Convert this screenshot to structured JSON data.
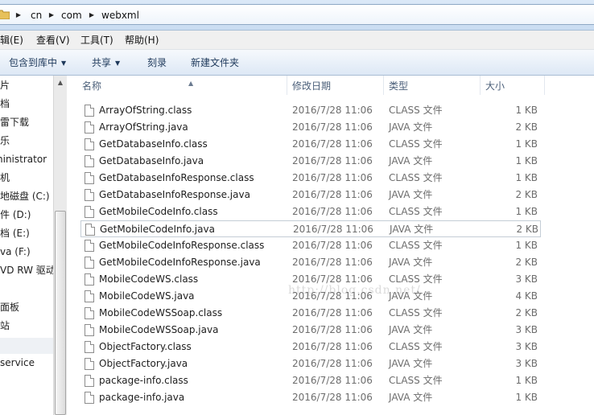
{
  "address": {
    "crumbs": [
      "cn",
      "com",
      "webxml"
    ]
  },
  "menu": [
    "编辑(E)",
    "查看(V)",
    "工具(T)",
    "帮助(H)"
  ],
  "commands": {
    "include_library": "包含到库中",
    "share": "共享",
    "burn": "刻录",
    "new_folder": "新建文件夹"
  },
  "nav": {
    "items": [
      "片",
      "档",
      "雷下载",
      "乐",
      "ninistrator",
      "机",
      "地磁盘 (C:)",
      "件 (D:)",
      "档 (E:)",
      "va (F:)",
      "VD RW 驱动",
      "面板",
      "站",
      "service"
    ]
  },
  "columns": {
    "name": "名称",
    "date": "修改日期",
    "type": "类型",
    "size": "大小"
  },
  "files": [
    {
      "name": "ArrayOfString.class",
      "date": "2016/7/28 11:06",
      "type": "CLASS 文件",
      "size": "1 KB"
    },
    {
      "name": "ArrayOfString.java",
      "date": "2016/7/28 11:06",
      "type": "JAVA 文件",
      "size": "2 KB"
    },
    {
      "name": "GetDatabaseInfo.class",
      "date": "2016/7/28 11:06",
      "type": "CLASS 文件",
      "size": "1 KB"
    },
    {
      "name": "GetDatabaseInfo.java",
      "date": "2016/7/28 11:06",
      "type": "JAVA 文件",
      "size": "1 KB"
    },
    {
      "name": "GetDatabaseInfoResponse.class",
      "date": "2016/7/28 11:06",
      "type": "CLASS 文件",
      "size": "1 KB"
    },
    {
      "name": "GetDatabaseInfoResponse.java",
      "date": "2016/7/28 11:06",
      "type": "JAVA 文件",
      "size": "2 KB"
    },
    {
      "name": "GetMobileCodeInfo.class",
      "date": "2016/7/28 11:06",
      "type": "CLASS 文件",
      "size": "1 KB"
    },
    {
      "name": "GetMobileCodeInfo.java",
      "date": "2016/7/28 11:06",
      "type": "JAVA 文件",
      "size": "2 KB"
    },
    {
      "name": "GetMobileCodeInfoResponse.class",
      "date": "2016/7/28 11:06",
      "type": "CLASS 文件",
      "size": "1 KB"
    },
    {
      "name": "GetMobileCodeInfoResponse.java",
      "date": "2016/7/28 11:06",
      "type": "JAVA 文件",
      "size": "2 KB"
    },
    {
      "name": "MobileCodeWS.class",
      "date": "2016/7/28 11:06",
      "type": "CLASS 文件",
      "size": "3 KB"
    },
    {
      "name": "MobileCodeWS.java",
      "date": "2016/7/28 11:06",
      "type": "JAVA 文件",
      "size": "4 KB"
    },
    {
      "name": "MobileCodeWSSoap.class",
      "date": "2016/7/28 11:06",
      "type": "CLASS 文件",
      "size": "2 KB"
    },
    {
      "name": "MobileCodeWSSoap.java",
      "date": "2016/7/28 11:06",
      "type": "JAVA 文件",
      "size": "3 KB"
    },
    {
      "name": "ObjectFactory.class",
      "date": "2016/7/28 11:06",
      "type": "CLASS 文件",
      "size": "3 KB"
    },
    {
      "name": "ObjectFactory.java",
      "date": "2016/7/28 11:06",
      "type": "JAVA 文件",
      "size": "3 KB"
    },
    {
      "name": "package-info.class",
      "date": "2016/7/28 11:06",
      "type": "CLASS 文件",
      "size": "1 KB"
    },
    {
      "name": "package-info.java",
      "date": "2016/7/28 11:06",
      "type": "JAVA 文件",
      "size": "1 KB"
    }
  ],
  "selected_file": "GetMobileCodeInfo.java",
  "watermark": "http://blog.csdn.net/",
  "icons": {
    "folder": "folder-icon",
    "file": "file-icon",
    "dropdown": "chevron-down-icon",
    "breadcrumb_separator": "chevron-right-icon",
    "sort": "sort-up-icon",
    "scroll_up": "scroll-up-icon"
  },
  "colors": {
    "selection_border": "#c4cdd6",
    "header_text": "#4c607a",
    "command_text": "#1e395b"
  }
}
